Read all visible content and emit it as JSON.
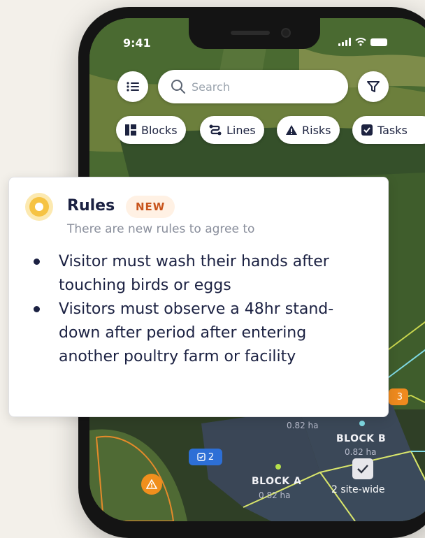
{
  "status_bar": {
    "time": "9:41"
  },
  "search": {
    "placeholder": "Search"
  },
  "chips": [
    {
      "label": "Blocks",
      "icon": "blocks-icon"
    },
    {
      "label": "Lines",
      "icon": "lines-icon"
    },
    {
      "label": "Risks",
      "icon": "warning-triangle-icon"
    },
    {
      "label": "Tasks",
      "icon": "checkbox-icon"
    }
  ],
  "rules_card": {
    "title": "Rules",
    "badge": "NEW",
    "subtitle": "There are new rules to agree to",
    "rules": [
      "Visitor must wash their hands after touching birds or eggs",
      "Visitors must observe a 48hr stand-down after period after entering another poultry farm or facility"
    ]
  },
  "map": {
    "blocks": [
      {
        "name": "BLOCK A",
        "area": "0.82 ha"
      },
      {
        "name": "BLOCK B",
        "area": "0.82 ha"
      }
    ],
    "unlabeled_area": "0.82 ha",
    "task_badge": "2",
    "risk_badge": "3",
    "sitewide_label": "2 site-wide"
  },
  "colors": {
    "accent_yellow": "#f6c343",
    "badge_text": "#c8541c",
    "task_blue": "#2d6fd6",
    "risk_orange": "#ee8a1e",
    "text_dark": "#1b2142"
  }
}
